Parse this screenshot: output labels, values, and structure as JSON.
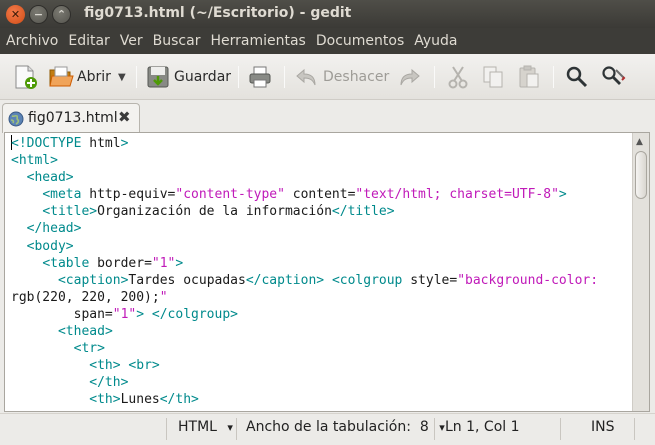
{
  "window": {
    "title": "fig0713.html (~/Escritorio) - gedit",
    "close_glyph": "✕",
    "min_glyph": "−",
    "max_glyph": "⌃"
  },
  "menu": [
    "Archivo",
    "Editar",
    "Ver",
    "Buscar",
    "Herramientas",
    "Documentos",
    "Ayuda"
  ],
  "toolbar": {
    "open_label": "Abrir",
    "dropdown_glyph": "▼",
    "save_label": "Guardar",
    "undo_label": "Deshacer",
    "icons": [
      "new-document-icon",
      "open-folder-icon",
      "save-icon",
      "print-icon",
      "undo-icon",
      "redo-icon",
      "cut-icon",
      "copy-icon",
      "paste-icon",
      "search-icon",
      "search-replace-icon"
    ]
  },
  "tab": {
    "label": "fig0713.html",
    "close_glyph": "✖"
  },
  "editor": {
    "lines": [
      "<!DOCTYPE html>",
      "<html>",
      "  <head>",
      "    <meta http-equiv=\"content-type\" content=\"text/html; charset=UTF-8\">",
      "    <title>Organización de la información</title>",
      "  </head>",
      "  <body>",
      "    <table border=\"1\">",
      "      <caption>Tardes ocupadas</caption> <colgroup style=\"background-color:",
      "rgb(220, 220, 200);\"",
      "        span=\"1\"> </colgroup>",
      "      <thead>",
      "        <tr>",
      "          <th> <br>",
      "          </th>",
      "          <th>Lunes</th>"
    ]
  },
  "statusbar": {
    "language": "HTML",
    "tab_width": "Ancho de la tabulación:  8",
    "position": "Ln 1, Col 1",
    "mode": "INS",
    "dropdown_glyph": "▾"
  },
  "colors": {
    "tag": "#008a8c",
    "attribute": "#6a5acd",
    "string": "#c01ab9",
    "titlebar": "#3d3c38",
    "close_button": "#e05a20"
  }
}
